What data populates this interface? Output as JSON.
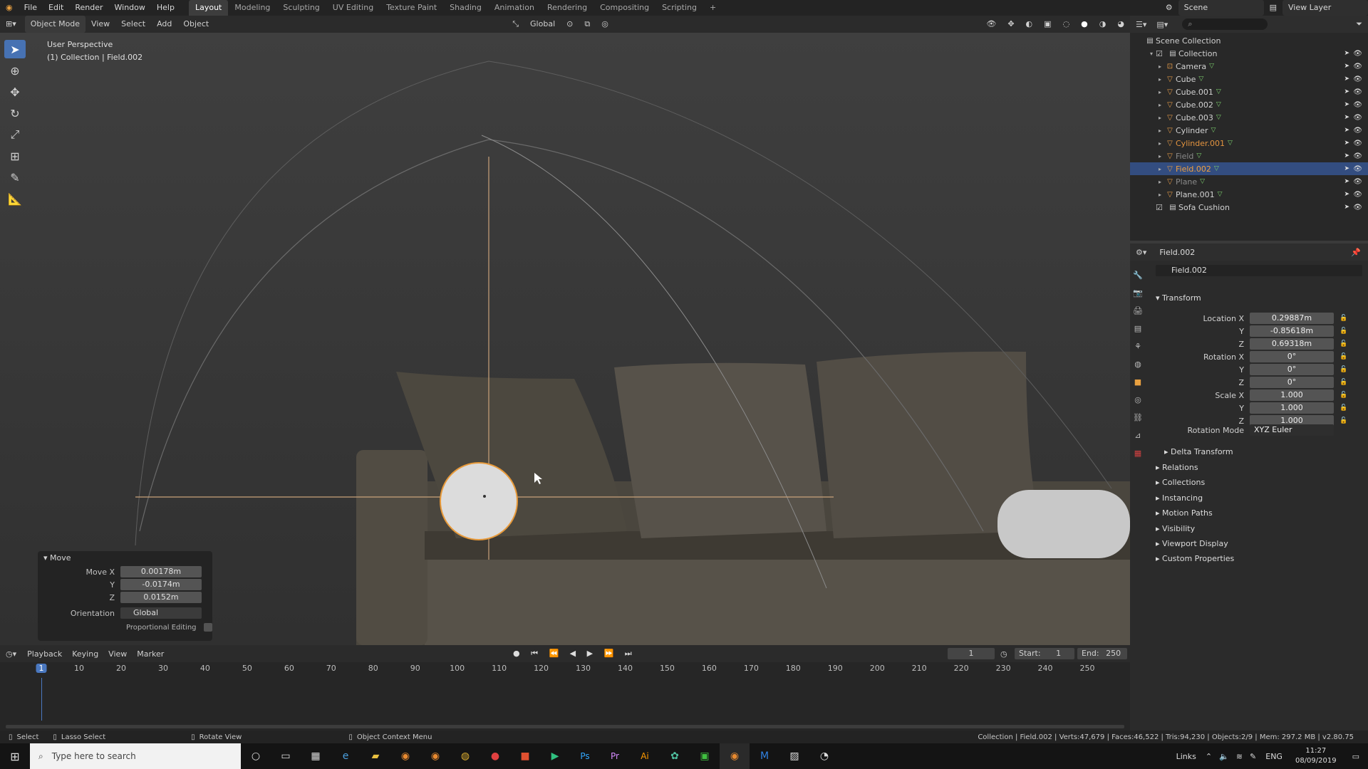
{
  "menu": [
    "File",
    "Edit",
    "Render",
    "Window",
    "Help"
  ],
  "workspaces": [
    "Layout",
    "Modeling",
    "Sculpting",
    "UV Editing",
    "Texture Paint",
    "Shading",
    "Animation",
    "Rendering",
    "Compositing",
    "Scripting"
  ],
  "top_right": {
    "scene": "Scene",
    "view_layer": "View Layer"
  },
  "viewport_header": {
    "mode": "Object Mode",
    "items": [
      "View",
      "Select",
      "Add",
      "Object"
    ],
    "orientation": "Global"
  },
  "viewport_info": {
    "perspective": "User Perspective",
    "collection": "(1) Collection | Field.002"
  },
  "move_panel": {
    "title": "Move",
    "rows": [
      {
        "label": "Move X",
        "value": "0.00178m"
      },
      {
        "label": "Y",
        "value": "-0.0174m"
      },
      {
        "label": "Z",
        "value": "0.0152m"
      }
    ],
    "orientation_label": "Orientation",
    "orientation_value": "Global",
    "proportional_label": "Proportional Editing"
  },
  "outliner": {
    "root": "Scene Collection",
    "collection": "Collection",
    "items": [
      {
        "name": "Camera",
        "color": "#d2d2d2"
      },
      {
        "name": "Cube",
        "color": "#d2d2d2"
      },
      {
        "name": "Cube.001",
        "color": "#d2d2d2"
      },
      {
        "name": "Cube.002",
        "color": "#d2d2d2"
      },
      {
        "name": "Cube.003",
        "color": "#d2d2d2"
      },
      {
        "name": "Cylinder",
        "color": "#d2d2d2"
      },
      {
        "name": "Cylinder.001",
        "color": "#e3943f"
      },
      {
        "name": "Field",
        "color": "#8a8a8a"
      },
      {
        "name": "Field.002",
        "color": "#f0a040"
      },
      {
        "name": "Plane",
        "color": "#8a8a8a"
      },
      {
        "name": "Plane.001",
        "color": "#d2d2d2"
      }
    ],
    "sofa": "Sofa Cushion"
  },
  "properties": {
    "header": "Field.002",
    "object_name": "Field.002",
    "transform_title": "Transform",
    "location": [
      {
        "label": "Location X",
        "value": "0.29887m"
      },
      {
        "label": "Y",
        "value": "-0.85618m"
      },
      {
        "label": "Z",
        "value": "0.69318m"
      }
    ],
    "rotation": [
      {
        "label": "Rotation X",
        "value": "0°"
      },
      {
        "label": "Y",
        "value": "0°"
      },
      {
        "label": "Z",
        "value": "0°"
      }
    ],
    "scale": [
      {
        "label": "Scale X",
        "value": "1.000"
      },
      {
        "label": "Y",
        "value": "1.000"
      },
      {
        "label": "Z",
        "value": "1.000"
      }
    ],
    "rotation_mode_label": "Rotation Mode",
    "rotation_mode": "XYZ Euler",
    "delta": "Delta Transform",
    "sections": [
      "Relations",
      "Collections",
      "Instancing",
      "Motion Paths",
      "Visibility",
      "Viewport Display",
      "Custom Properties"
    ]
  },
  "timeline": {
    "items": [
      "Playback",
      "Keying",
      "View",
      "Marker"
    ],
    "current_frame": "1",
    "start_label": "Start:",
    "start": "1",
    "end_label": "End:",
    "end": "250",
    "ticks": [
      "1",
      "10",
      "20",
      "30",
      "40",
      "50",
      "60",
      "70",
      "80",
      "90",
      "100",
      "110",
      "120",
      "130",
      "140",
      "150",
      "160",
      "170",
      "180",
      "190",
      "200",
      "210",
      "220",
      "230",
      "240",
      "250"
    ]
  },
  "statusbar": {
    "select": "Select",
    "lasso": "Lasso Select",
    "rotate": "Rotate View",
    "context": "Object Context Menu",
    "info": "Collection | Field.002 | Verts:47,679 | Faces:46,522 | Tris:94,230 | Objects:2/9 | Mem: 297.2 MB | v2.80.75"
  },
  "taskbar": {
    "search_placeholder": "Type here to search",
    "links": "Links",
    "lang": "ENG",
    "time": "11:27",
    "date": "08/09/2019"
  }
}
